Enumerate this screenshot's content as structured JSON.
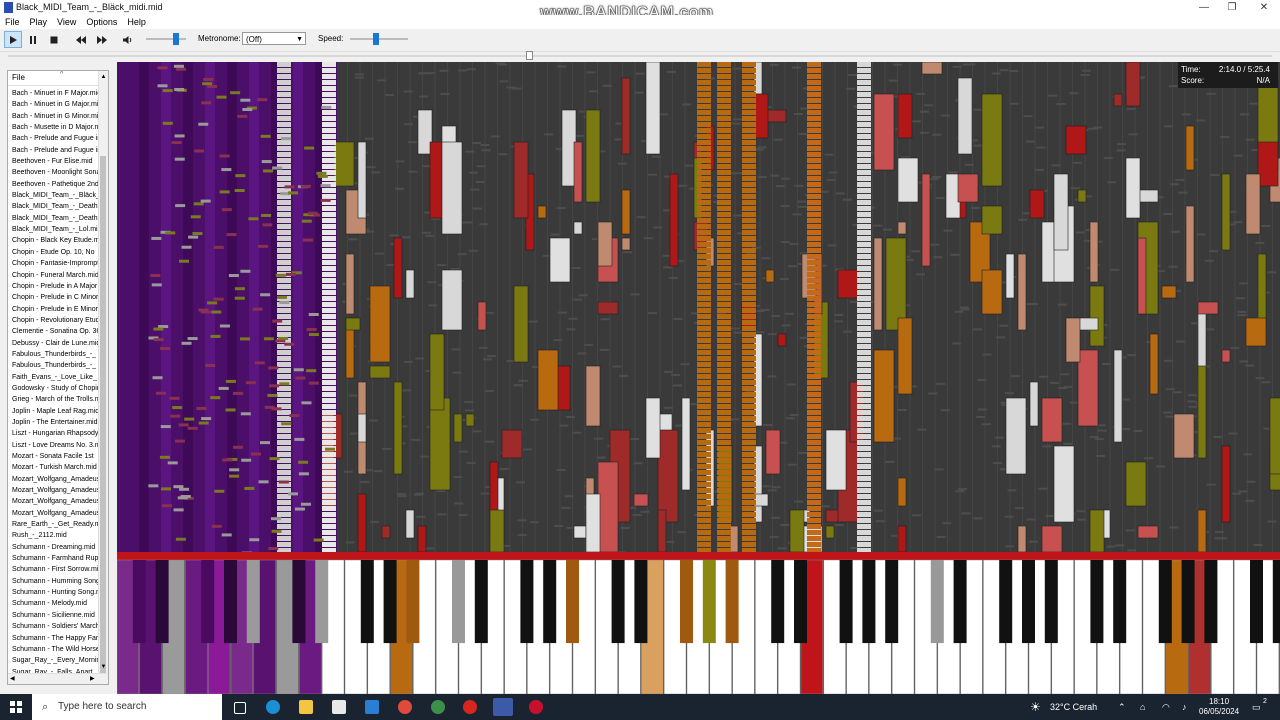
{
  "window": {
    "title": "Black_MIDI_Team_-_Bläck_midi.mid",
    "watermark": "www.BANDICAM.com",
    "controls": [
      "—",
      "❐",
      "✕"
    ]
  },
  "menu": [
    "File",
    "Play",
    "View",
    "Options",
    "Help"
  ],
  "toolbar": {
    "metronome_label": "Metronome:",
    "metronome_value": "(Off)",
    "speed_label": "Speed:",
    "volume_level": 0.8,
    "speed_level": 0.45,
    "icons": [
      "play-icon",
      "pause-icon",
      "stop-icon",
      "rewind-icon",
      "fast-forward-icon",
      "volume-icon"
    ]
  },
  "playback": {
    "position_fraction": 0.41
  },
  "filelist": {
    "header": "File",
    "sort_glyph": "^",
    "items": [
      "Bach - Minuet in F Major.mid",
      "Bach - Minuet in G Major.mid",
      "Bach - Minuet in G Minor.mid",
      "Bach - Musette in D Major.mid",
      "Bach - Prelude and Fugue in",
      "Bach - Prelude and Fugue in",
      "Beethoven - Fur Elise.mid",
      "Beethoven - Moonlight Sonata",
      "Beethoven - Pathetique 2nd",
      "Black_MIDI_Team_-_Bläck_midi",
      "Black_MIDI_Team_-_Death",
      "Black_MIDI_Team_-_Death",
      "Black_MIDI_Team_-_Lol.mid",
      "Chopin - Black Key Etude.mid",
      "Chopin - Etude Op. 10, No",
      "Chopin - Fantasie-Impromptu",
      "Chopin - Funeral March.mid",
      "Chopin - Prelude in A Major",
      "Chopin - Prelude in C Minor",
      "Chopin - Prelude in E Minor",
      "Chopin - Revolutionary Etude",
      "Clementie - Sonatina Op. 36",
      "Debussy - Clair de Lune.mid",
      "Fabulous_Thunderbirds_-_",
      "Fabulous_Thunderbirds_-_",
      "Faith_Evans_-_Love_Like_",
      "Godowsky - Study of Chopin",
      "Grieg - March of the Trolls.mid",
      "Joplin - Maple Leaf Rag.mid",
      "Joplin - The Entertainer.mid",
      "Liszt - Hungarian Rhapsody",
      "Liszt - Love Dreams No. 3.mid",
      "Mozart - Sonata Facile 1st",
      "Mozart - Turkish March.mid",
      "Mozart_Wolfgang_Amadeus",
      "Mozart_Wolfgang_Amadeus",
      "Mozart_Wolfgang_Amadeus",
      "Mozart_Wolfgang_Amadeus",
      "Rare_Earth_-_Get_Ready.mid",
      "Rush_-_2112.mid",
      "Schumann - Dreaming.mid",
      "Schumann - Farmhand Rupert",
      "Schumann - First Sorrow.mid",
      "Schumann - Humming Song.mid",
      "Schumann - Hunting Song.mid",
      "Schumann - Melody.mid",
      "Schumann - Sicilienne.mid",
      "Schumann - Soldiers' March",
      "Schumann - The Happy Farmer",
      "Schumann - The Wild Horseman",
      "Sugar_Ray_-_Every_Morning",
      "Sugar_Ray_-_Falls_Apart"
    ]
  },
  "hud": {
    "time_label": "Time:",
    "time_value": "2:14.0 / 5:25.4",
    "score_label": "Score:",
    "score_value": "N/A"
  },
  "taskbar": {
    "search_placeholder": "Type here to search",
    "weather": "32°C  Cerah",
    "time": "18:10",
    "date": "06/05/2024",
    "notifications": "2"
  },
  "colors": {
    "accent": "#1976d2",
    "canvas": "#3a3a3a",
    "keyboard_bar": "#c0141b",
    "taskbar": "#1a2330"
  }
}
